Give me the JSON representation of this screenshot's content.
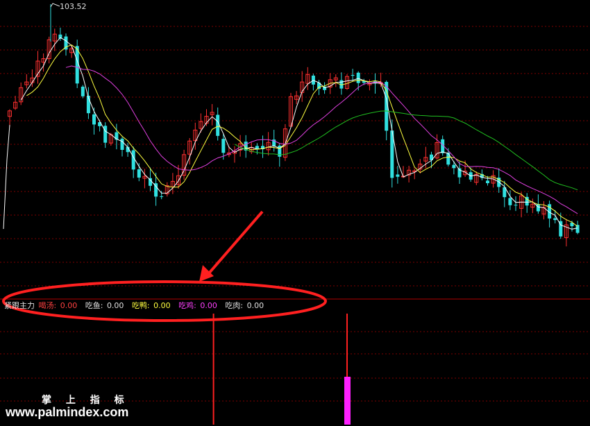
{
  "chart_data": {
    "type": "candlestick",
    "price_high_label": "103.52",
    "legend": {
      "name": "紧跟主力",
      "items": [
        {
          "label": "喝汤:",
          "value": "0.00",
          "color": "#ff4040"
        },
        {
          "label": "吃鱼:",
          "value": "0.00",
          "color": "#e0e0e0"
        },
        {
          "label": "吃鸭:",
          "value": "0.00",
          "color": "#ffff40"
        },
        {
          "label": "吃鸡:",
          "value": "0.00",
          "color": "#ff40ff"
        },
        {
          "label": "吃肉:",
          "value": "0.00",
          "color": "#e0e0e0"
        }
      ]
    },
    "signals": [
      {
        "type": "red-line",
        "bar": 36,
        "value": 1.0
      },
      {
        "type": "magenta-bar",
        "bar": 60,
        "value": 1.0
      }
    ]
  },
  "colors": {
    "up": "#ff3030",
    "down": "#30e0e0",
    "ma_white": "#ffffff",
    "ma_yellow": "#ffff40",
    "ma_magenta": "#e040e0",
    "ma_green": "#20c020",
    "grid": "#800000",
    "annotation": "#ff2020"
  },
  "watermark": {
    "title": "掌 上 指 标",
    "url": "www.palmindex.com"
  }
}
